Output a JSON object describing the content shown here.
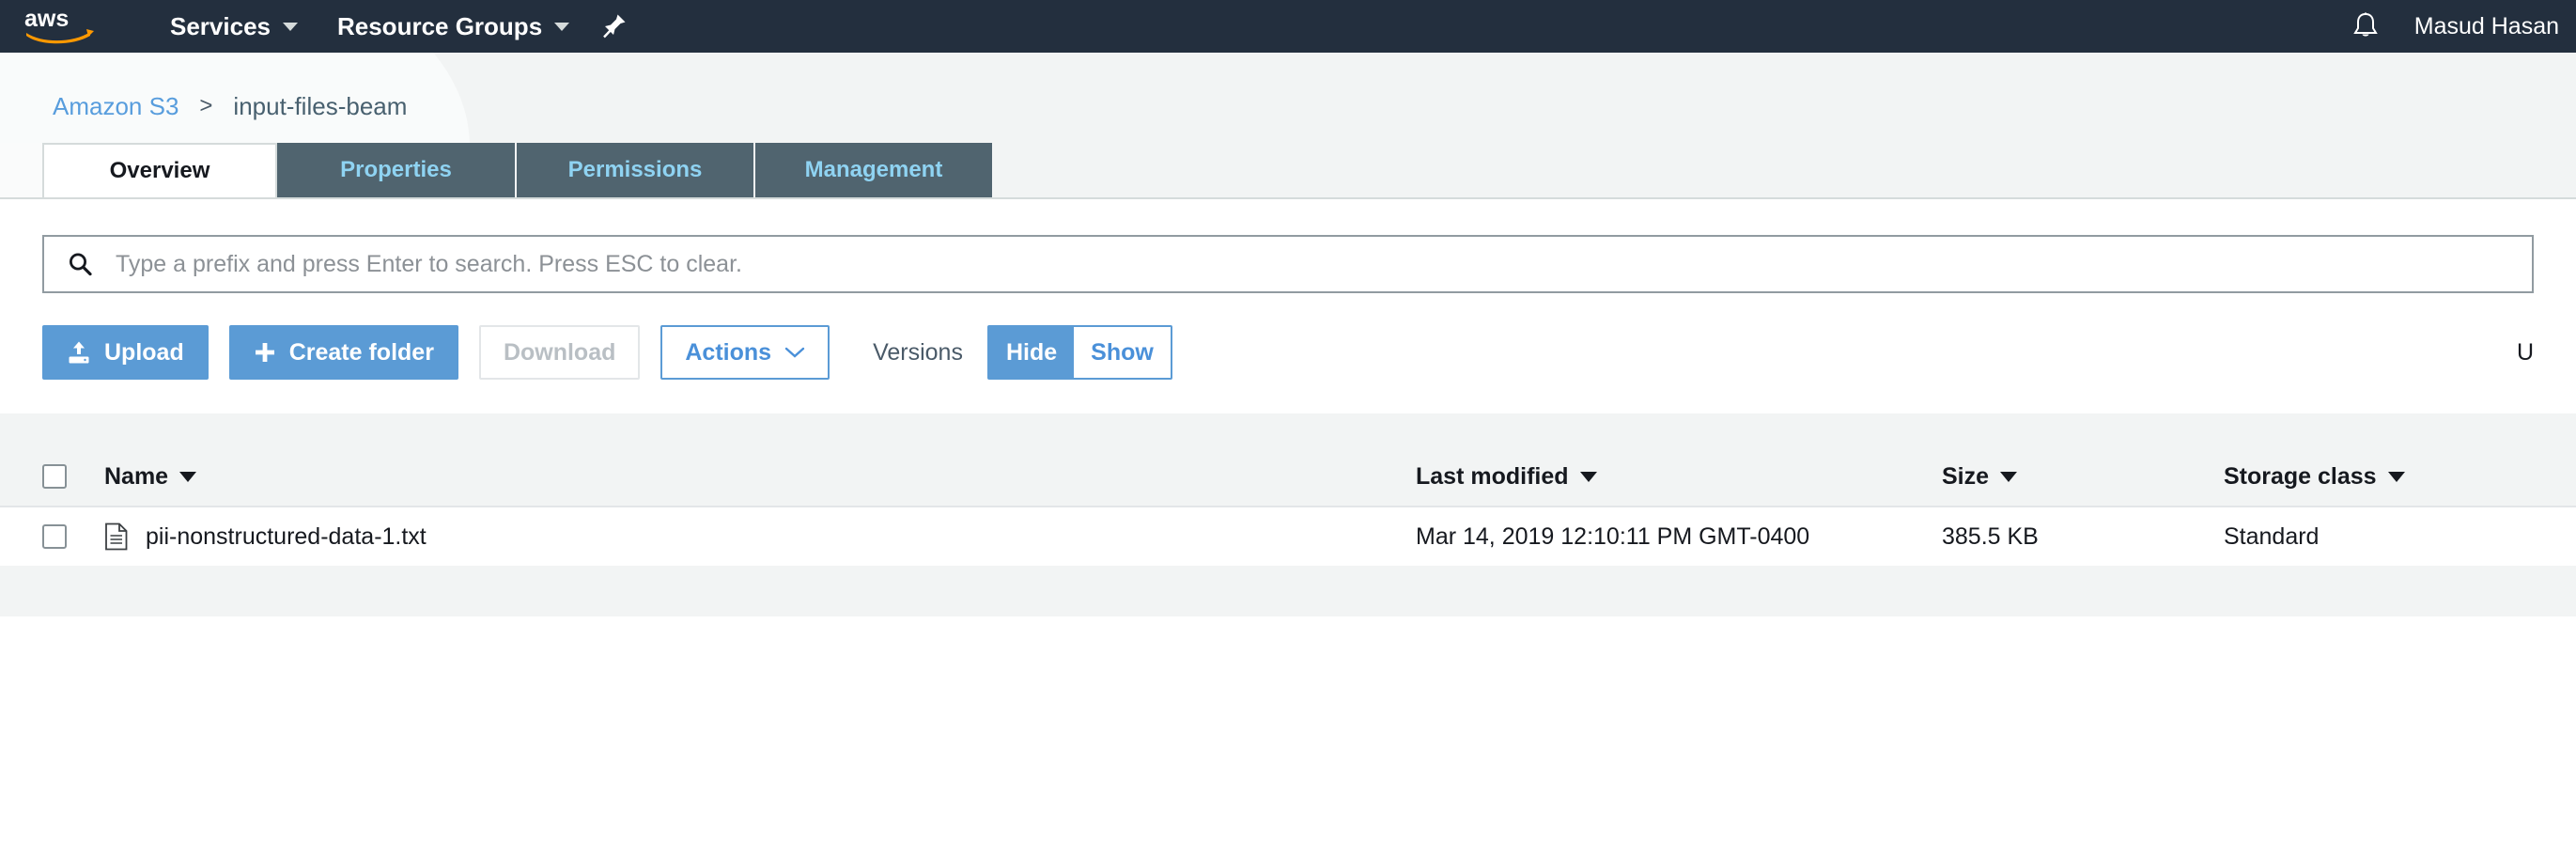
{
  "topnav": {
    "logo_alt": "aws",
    "items": [
      {
        "label": "Services",
        "icon": "chevron-down-icon"
      },
      {
        "label": "Resource Groups",
        "icon": "chevron-down-icon"
      }
    ],
    "pin_icon": "pin-icon",
    "bell_icon": "bell-icon",
    "user": "Masud Hasan",
    "bg_color": "#232f3e"
  },
  "breadcrumb": {
    "root": "Amazon S3",
    "separator": ">",
    "current": "input-files-beam",
    "link_color": "#589ddd"
  },
  "tabs": [
    {
      "label": "Overview",
      "active": true
    },
    {
      "label": "Properties",
      "active": false
    },
    {
      "label": "Permissions",
      "active": false
    },
    {
      "label": "Management",
      "active": false
    }
  ],
  "search": {
    "icon": "search-icon",
    "value": "",
    "placeholder": "Type a prefix and press Enter to search. Press ESC to clear."
  },
  "toolbar": {
    "upload_label": "Upload",
    "upload_icon": "upload-icon",
    "create_folder_label": "Create folder",
    "create_folder_icon": "plus-icon",
    "download_label": "Download",
    "actions_label": "Actions",
    "actions_icon": "chevron-down-icon",
    "versions_label": "Versions",
    "versions_hide": "Hide",
    "versions_show": "Show",
    "versions_selected": "Hide",
    "region_partial": "U",
    "primary_color": "#5b9bd5",
    "link_color": "#4a90d9"
  },
  "table": {
    "select_all_checkbox": false,
    "columns": [
      {
        "key": "name",
        "label": "Name",
        "sortable": true
      },
      {
        "key": "mod",
        "label": "Last modified",
        "sortable": true
      },
      {
        "key": "size",
        "label": "Size",
        "sortable": true
      },
      {
        "key": "class",
        "label": "Storage class",
        "sortable": true
      }
    ],
    "rows": [
      {
        "selected": false,
        "icon": "file-icon",
        "name": "pii-nonstructured-data-1.txt",
        "mod": "Mar 14, 2019 12:10:11 PM GMT-0400",
        "size": "385.5 KB",
        "class": "Standard"
      }
    ]
  }
}
